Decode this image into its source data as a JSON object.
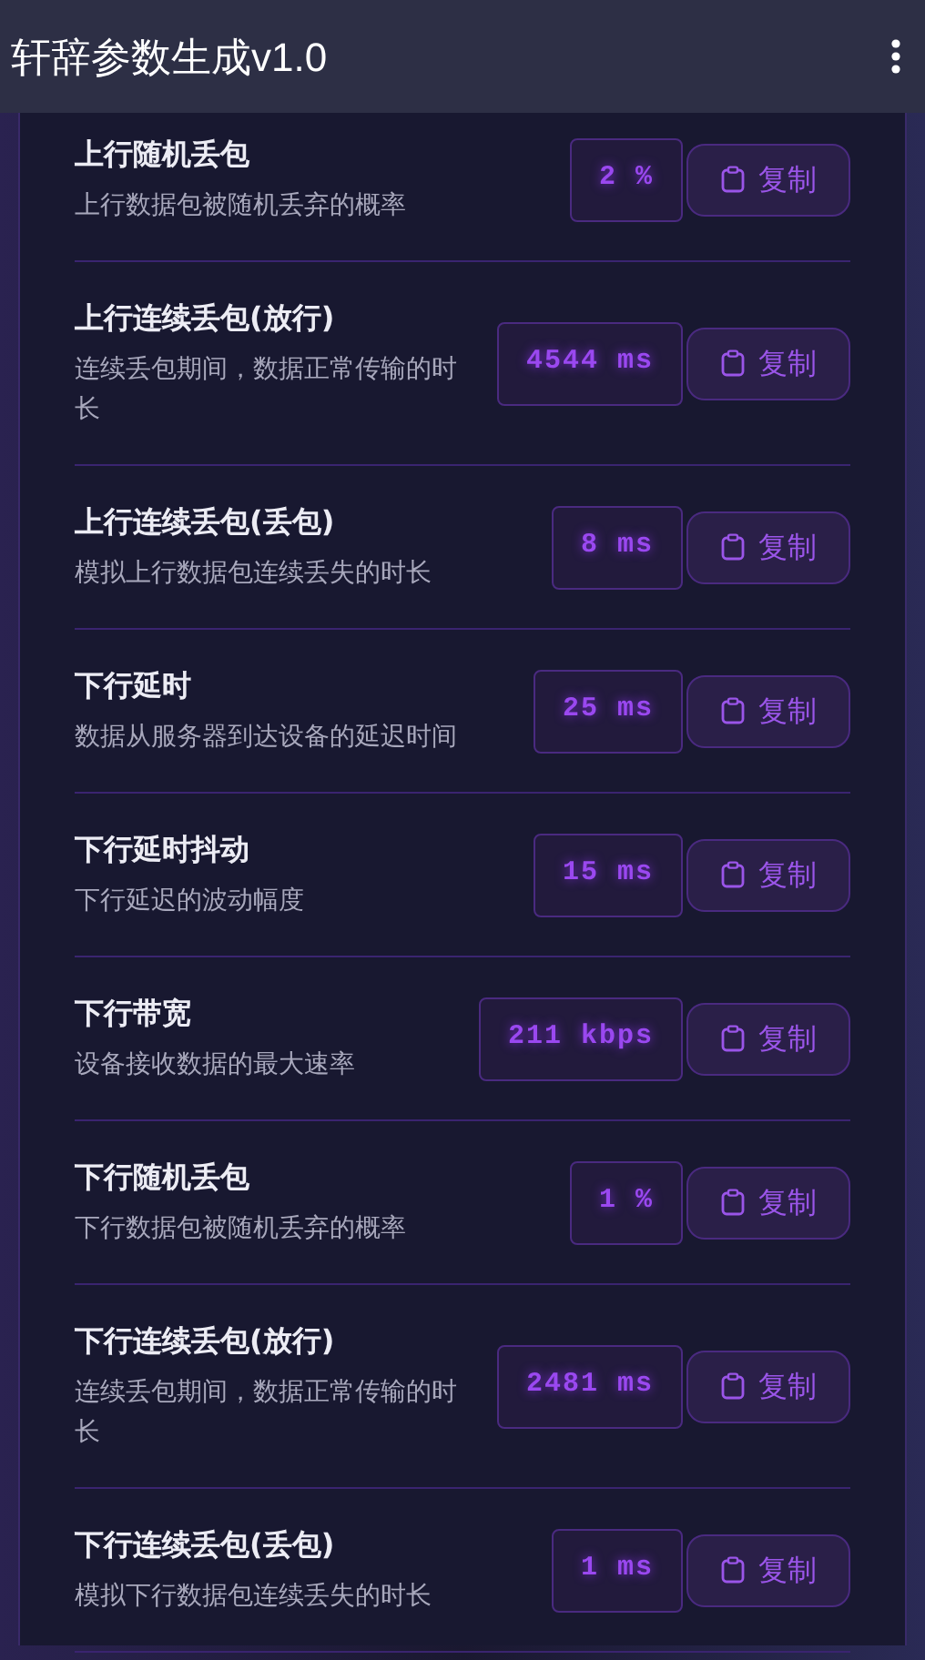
{
  "app_bar": {
    "title": "轩辞参数生成v1.0"
  },
  "params": [
    {
      "title": "上行随机丢包",
      "description": "上行数据包被随机丢弃的概率",
      "value": "2 %",
      "copy_label": "复制"
    },
    {
      "title": "上行连续丢包(放行)",
      "description": "连续丢包期间，数据正常传输的时长",
      "value": "4544 ms",
      "copy_label": "复制"
    },
    {
      "title": "上行连续丢包(丢包)",
      "description": "模拟上行数据包连续丢失的时长",
      "value": "8 ms",
      "copy_label": "复制"
    },
    {
      "title": "下行延时",
      "description": "数据从服务器到达设备的延迟时间",
      "value": "25 ms",
      "copy_label": "复制"
    },
    {
      "title": "下行延时抖动",
      "description": "下行延迟的波动幅度",
      "value": "15 ms",
      "copy_label": "复制"
    },
    {
      "title": "下行带宽",
      "description": "设备接收数据的最大速率",
      "value": "211 kbps",
      "copy_label": "复制"
    },
    {
      "title": "下行随机丢包",
      "description": "下行数据包被随机丢弃的概率",
      "value": "1 %",
      "copy_label": "复制"
    },
    {
      "title": "下行连续丢包(放行)",
      "description": "连续丢包期间，数据正常传输的时长",
      "value": "2481 ms",
      "copy_label": "复制"
    },
    {
      "title": "下行连续丢包(丢包)",
      "description": "模拟下行数据包连续丢失的时长",
      "value": "1 ms",
      "copy_label": "复制"
    }
  ]
}
